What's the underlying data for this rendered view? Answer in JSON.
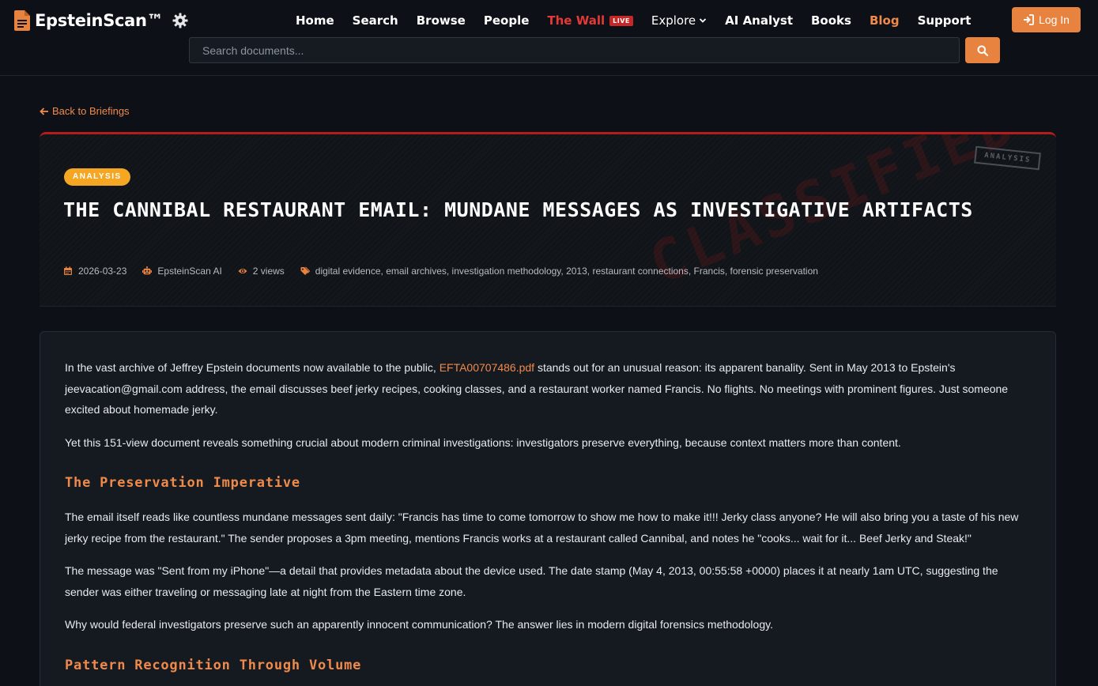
{
  "brand": {
    "name": "EpsteinScan™"
  },
  "nav": {
    "home": "Home",
    "search": "Search",
    "browse": "Browse",
    "people": "People",
    "wall": "The Wall",
    "live_badge": "LIVE",
    "explore": "Explore",
    "ai_analyst": "AI Analyst",
    "books": "Books",
    "blog": "Blog",
    "support": "Support"
  },
  "login": {
    "label": "Log In"
  },
  "search": {
    "placeholder": "Search documents..."
  },
  "back_link": "Back to Briefings",
  "hero": {
    "category": "ANALYSIS",
    "stamp": "ANALYSIS",
    "watermark": "CLASSIFIED",
    "title": "THE CANNIBAL RESTAURANT EMAIL: MUNDANE MESSAGES AS INVESTIGATIVE ARTIFACTS",
    "date": "2026-03-23",
    "author": "EpsteinScan AI",
    "views": "2 views",
    "tags": "digital evidence, email archives, investigation methodology, 2013, restaurant connections, Francis, forensic preservation"
  },
  "article": {
    "p1_before": "In the vast archive of Jeffrey Epstein documents now available to the public, ",
    "p1_link": "EFTA00707486.pdf",
    "p1_after": " stands out for an unusual reason: its apparent banality. Sent in May 2013 to Epstein's jeevacation@gmail.com address, the email discusses beef jerky recipes, cooking classes, and a restaurant worker named Francis. No flights. No meetings with prominent figures. Just someone excited about homemade jerky.",
    "p2": "Yet this 151-view document reveals something crucial about modern criminal investigations: investigators preserve everything, because context matters more than content.",
    "h2_1": "The Preservation Imperative",
    "p3": "The email itself reads like countless mundane messages sent daily: \"Francis has time to come tomorrow to show me how to make it!!! Jerky class anyone? He will also bring you a taste of his new jerky recipe from the restaurant.\" The sender proposes a 3pm meeting, mentions Francis works at a restaurant called Cannibal, and notes he \"cooks... wait for it... Beef Jerky and Steak!\"",
    "p4": "The message was \"Sent from my iPhone\"—a detail that provides metadata about the device used. The date stamp (May 4, 2013, 00:55:58 +0000) places it at nearly 1am UTC, suggesting the sender was either traveling or messaging late at night from the Eastern time zone.",
    "p5": "Why would federal investigators preserve such an apparently innocent communication? The answer lies in modern digital forensics methodology.",
    "h2_2": "Pattern Recognition Through Volume"
  },
  "colors": {
    "accent": "#e8823f",
    "live": "#c62828",
    "wall": "#e53935",
    "pill": "#f5a623",
    "background": "#0d1117"
  }
}
